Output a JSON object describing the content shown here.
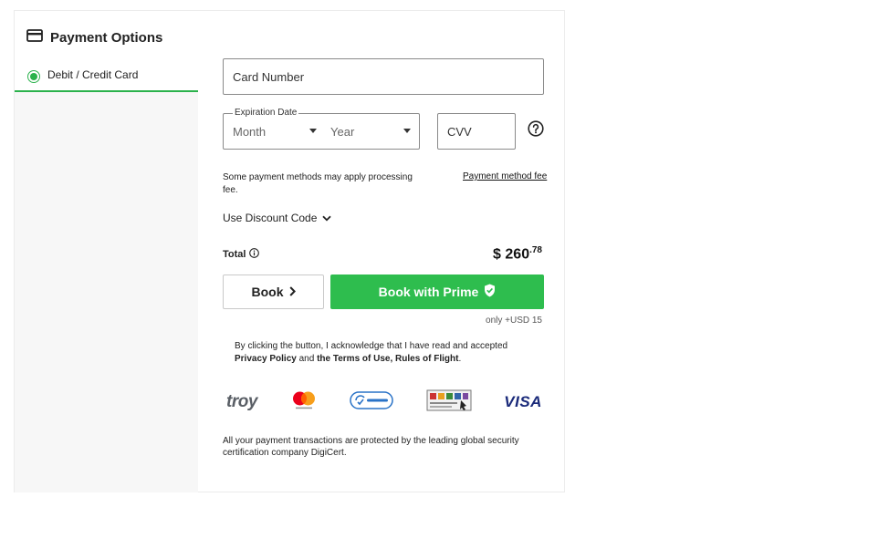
{
  "header": {
    "title": "Payment Options",
    "icon": "credit-card-icon"
  },
  "methods": [
    {
      "label": "Debit / Credit Card",
      "selected": true
    }
  ],
  "form": {
    "card_number_placeholder": "Card Number",
    "expiration_label": "Expiration Date",
    "month_placeholder": "Month",
    "year_placeholder": "Year",
    "cvv_placeholder": "CVV"
  },
  "fee": {
    "note": "Some payment methods may apply processing fee.",
    "link": "Payment method fee"
  },
  "discount": {
    "label": "Use Discount Code"
  },
  "total": {
    "label": "Total",
    "currency": "$",
    "amount_main": "260",
    "amount_decimal": ".78"
  },
  "buttons": {
    "book_label": "Book",
    "prime_label": "Book with Prime",
    "prime_extra": "only +USD 15"
  },
  "consent": {
    "prefix": "By clicking the button, I acknowledge that I have read and accepted",
    "privacy_policy": "Privacy Policy",
    "and": "and",
    "terms": "the Terms of Use, Rules of Flight",
    "suffix": "."
  },
  "logos": {
    "troy": "troy",
    "mastercard": "mastercard",
    "digicert": "digicert",
    "visa": "VISA"
  },
  "security_note": "All your payment transactions are protected by the leading global security certification company DigiCert.",
  "colors": {
    "accent_green": "#2ebd4e",
    "prime_button": "#2ebd4e",
    "sidebar_bg": "#f7f7f7"
  }
}
